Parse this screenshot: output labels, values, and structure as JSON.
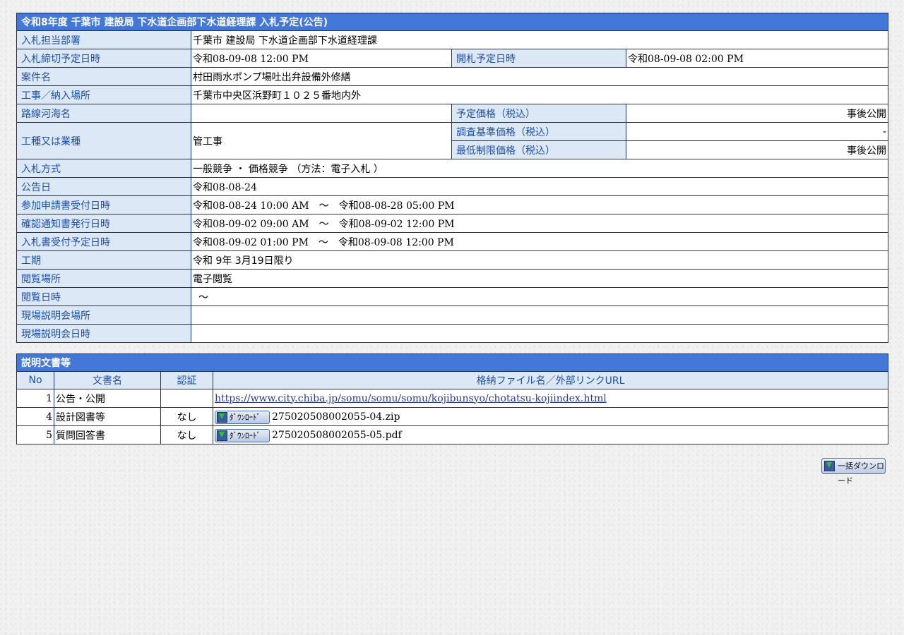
{
  "info_title": "令和8年度 千葉市 建設局 下水道企画部下水道経理課 入札予定(公告)",
  "rows": {
    "dept_label": "入札担当部署",
    "dept_value": "千葉市 建設局 下水道企画部下水道経理課",
    "deadline_label": "入札締切予定日時",
    "deadline_value": "令和08-09-08 12:00 PM",
    "opening_label": "開札予定日時",
    "opening_value": "令和08-09-08 02:00 PM",
    "project_label": "案件名",
    "project_value": "村田雨水ポンプ場吐出弁設備外修繕",
    "location_label": "工事／納入場所",
    "location_value": "千葉市中央区浜野町１０２５番地内外",
    "route_label": "路線河海名",
    "route_value": "",
    "est_price_label": "予定価格（税込）",
    "est_price_value": "事後公開",
    "type_label": "工種又は業種",
    "type_value": "管工事",
    "survey_price_label": "調査基準価格（税込）",
    "survey_price_value": "-",
    "min_price_label": "最低制限価格（税込）",
    "min_price_value": "事後公開",
    "method_label": "入札方式",
    "method_value": "一般競争 ・ 価格競争 （方法：電子入札 ）",
    "notice_label": "公告日",
    "notice_value": "令和08-08-24",
    "apply_label": "参加申請書受付日時",
    "apply_value": "令和08-08-24 10:00 AM　～　令和08-08-28 05:00 PM",
    "confirm_label": "確認通知書発行日時",
    "confirm_value": "令和08-09-02 09:00 AM　～　令和08-09-02 12:00 PM",
    "bid_accept_label": "入札書受付予定日時",
    "bid_accept_value": "令和08-09-02 01:00 PM　～　令和08-09-08 12:00 PM",
    "period_label": "工期",
    "period_value": "令和 9年 3月19日限り",
    "view_place_label": "閲覧場所",
    "view_place_value": "電子閲覧",
    "view_time_label": "閲覧日時",
    "view_time_value": "～",
    "site_place_label": "現場説明会場所",
    "site_place_value": "",
    "site_time_label": "現場説明会日時",
    "site_time_value": ""
  },
  "docs": {
    "title": "説明文書等",
    "columns": [
      "No",
      "文書名",
      "認証",
      "格納ファイル名／外部リンクURL"
    ],
    "download_label": "ﾀﾞｳﾝﾛｰﾄﾞ",
    "items": [
      {
        "no": "1",
        "name": "公告・公開",
        "auth": "",
        "file": "https://www.city.chiba.jp/somu/somu/somu/kojibunsyo/chotatsu-kojiindex.html"
      },
      {
        "no": "4",
        "name": "設計図書等",
        "auth": "なし",
        "file": "275020508002055-04.zip"
      },
      {
        "no": "5",
        "name": "質問回答書",
        "auth": "なし",
        "file": "275020508002055-05.pdf"
      }
    ]
  },
  "bulk_download_label": "一括ダウンロード"
}
